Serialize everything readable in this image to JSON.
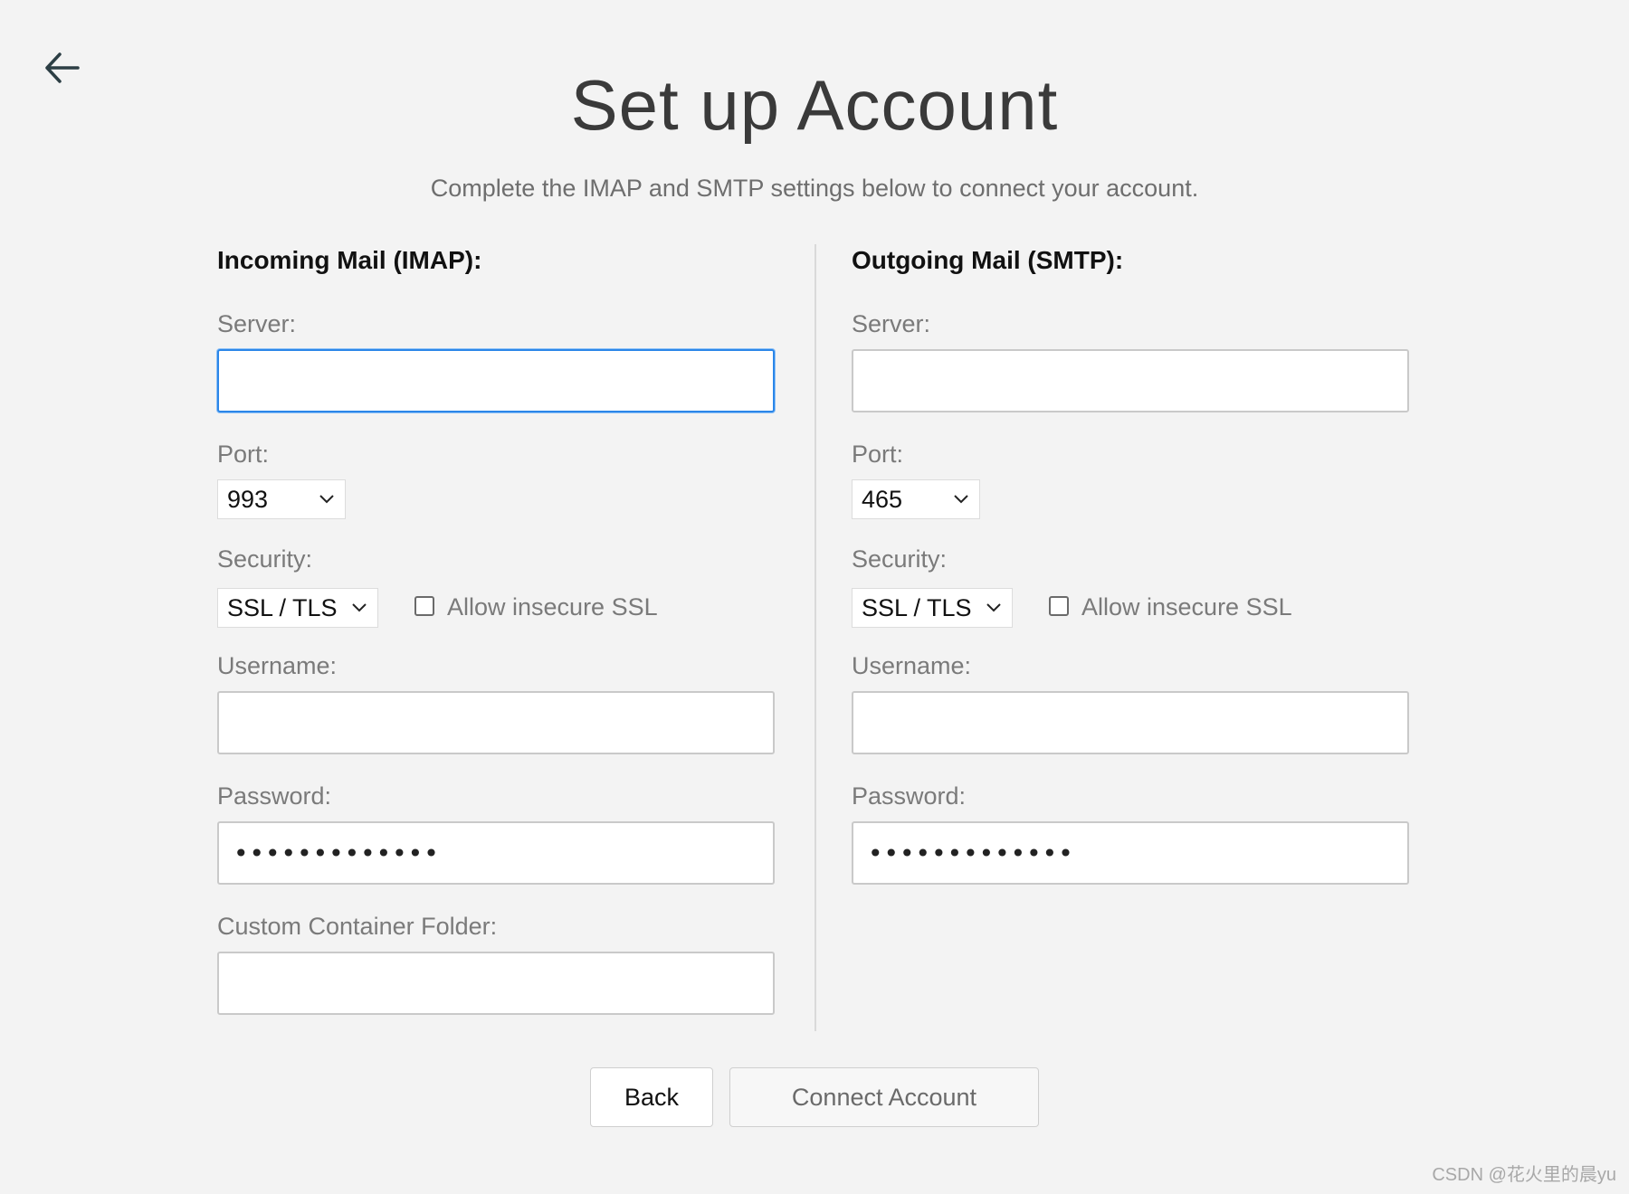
{
  "header": {
    "title": "Set up Account",
    "subtitle": "Complete the IMAP and SMTP settings below to connect your account."
  },
  "incoming": {
    "section_title": "Incoming Mail (IMAP):",
    "server_label": "Server:",
    "server_value": "",
    "port_label": "Port:",
    "port_value": "993",
    "security_label": "Security:",
    "security_value": "SSL / TLS",
    "allow_insecure_label": "Allow insecure SSL",
    "allow_insecure_checked": false,
    "username_label": "Username:",
    "username_value": "",
    "password_label": "Password:",
    "password_masked": "•••••••••••••",
    "folder_label": "Custom Container Folder:",
    "folder_value": ""
  },
  "outgoing": {
    "section_title": "Outgoing Mail (SMTP):",
    "server_label": "Server:",
    "server_value": "",
    "port_label": "Port:",
    "port_value": "465",
    "security_label": "Security:",
    "security_value": "SSL / TLS",
    "allow_insecure_label": "Allow insecure SSL",
    "allow_insecure_checked": false,
    "username_label": "Username:",
    "username_value": "",
    "password_label": "Password:",
    "password_masked": "•••••••••••••"
  },
  "actions": {
    "back_label": "Back",
    "connect_label": "Connect Account"
  },
  "watermark": "CSDN @花火里的晨yu",
  "icons": {
    "back": "arrow-left-icon",
    "dropdown": "chevron-down-icon"
  },
  "colors": {
    "background": "#f3f3f3",
    "focus_border": "#2b86e8",
    "input_border": "#c9c9c9",
    "label_text": "#7a7a7a"
  }
}
